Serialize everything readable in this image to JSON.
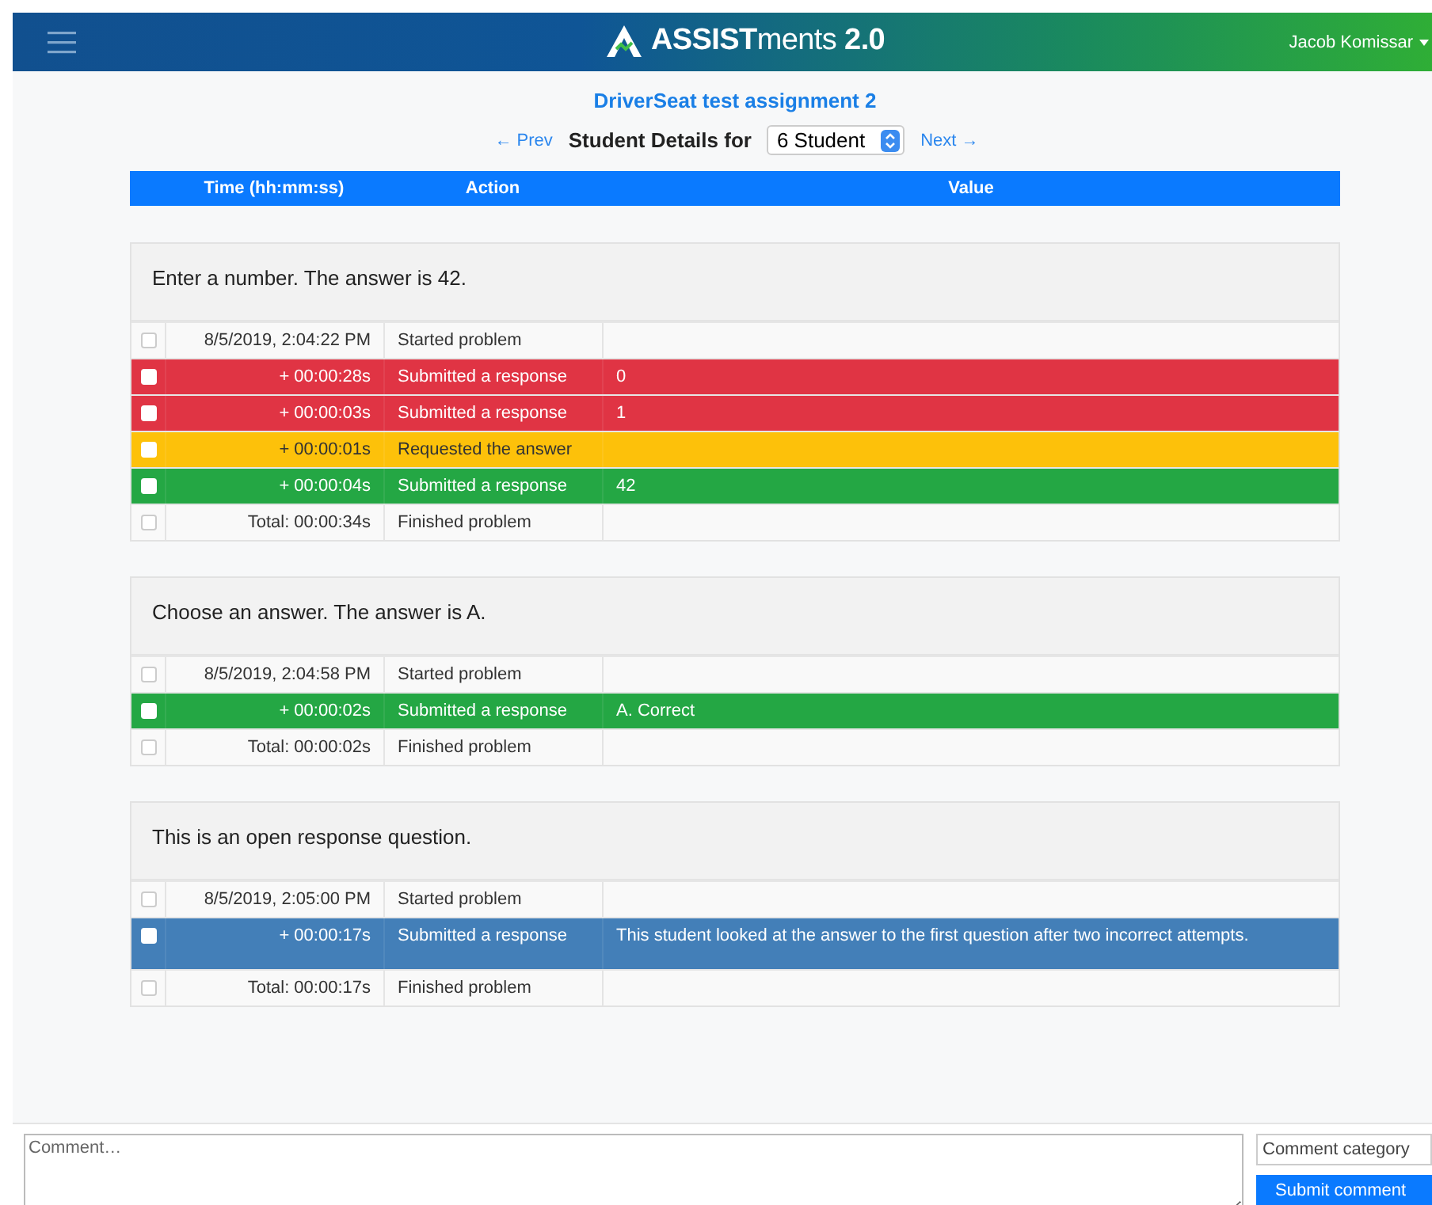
{
  "header": {
    "logo": "**ASSIST**ments **2.0**",
    "user": "Jacob Komissar"
  },
  "assignment_title": "DriverSeat test assignment 2",
  "nav": {
    "prev": "← Prev",
    "label": "Student Details for",
    "student": "6 Student",
    "next": "Next →"
  },
  "table": {
    "columns": [
      "Time (hh:mm:ss)",
      "Action",
      "Value"
    ]
  },
  "problems": [
    {
      "title": "Enter a number. The answer is 42.",
      "rows": [
        {
          "kind": "neutral",
          "checked": false,
          "time": "8/5/2019, 2:04:22 PM",
          "action": "Started problem",
          "value": ""
        },
        {
          "kind": "wrong",
          "checked": false,
          "time": "+ 00:00:28s",
          "action": "Submitted a response",
          "value": "0"
        },
        {
          "kind": "wrong",
          "checked": false,
          "time": "+ 00:00:03s",
          "action": "Submitted a response",
          "value": "1"
        },
        {
          "kind": "hint",
          "checked": false,
          "time": "+ 00:00:01s",
          "action": "Requested the answer",
          "value": ""
        },
        {
          "kind": "correct",
          "checked": false,
          "time": "+ 00:00:04s",
          "action": "Submitted a response",
          "value": "42"
        },
        {
          "kind": "neutral",
          "checked": false,
          "time": "Total: 00:00:34s",
          "action": "Finished problem",
          "value": ""
        }
      ]
    },
    {
      "title": "Choose an answer. The answer is A.",
      "rows": [
        {
          "kind": "neutral",
          "checked": false,
          "time": "8/5/2019, 2:04:58 PM",
          "action": "Started problem",
          "value": ""
        },
        {
          "kind": "correct",
          "checked": false,
          "time": "+ 00:00:02s",
          "action": "Submitted a response",
          "value": "A. Correct"
        },
        {
          "kind": "neutral",
          "checked": false,
          "time": "Total: 00:00:02s",
          "action": "Finished problem",
          "value": ""
        }
      ]
    },
    {
      "title": "This is an open response question.",
      "rows": [
        {
          "kind": "neutral",
          "checked": false,
          "time": "8/5/2019, 2:05:00 PM",
          "action": "Started problem",
          "value": ""
        },
        {
          "kind": "open",
          "checked": false,
          "time": "+ 00:00:17s",
          "action": "Submitted a response",
          "value": "This student looked at the answer to the first question after two incorrect attempts."
        },
        {
          "kind": "neutral",
          "checked": false,
          "time": "Total: 00:00:17s",
          "action": "Finished problem",
          "value": ""
        }
      ]
    }
  ],
  "comment": {
    "placeholder": "Comment…",
    "category": "Comment category",
    "submit": "Submit comment"
  }
}
